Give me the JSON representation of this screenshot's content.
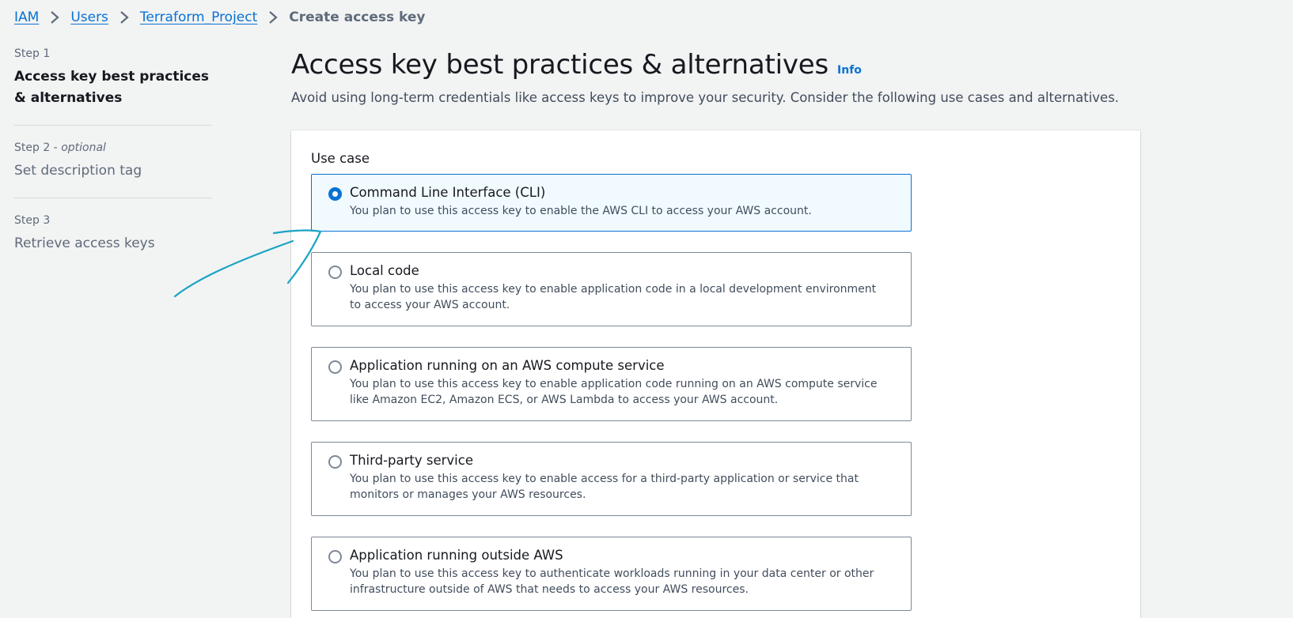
{
  "breadcrumb": {
    "items": [
      "IAM",
      "Users",
      "Terraform_Project"
    ],
    "current": "Create access key"
  },
  "steps": [
    {
      "number": "Step 1",
      "optional": "",
      "title": "Access key best practices & alternatives",
      "active": true
    },
    {
      "number": "Step 2 - ",
      "optional": "optional",
      "title": "Set description tag",
      "active": false
    },
    {
      "number": "Step 3",
      "optional": "",
      "title": "Retrieve access keys",
      "active": false
    }
  ],
  "header": {
    "title": "Access key best practices & alternatives",
    "info": "Info",
    "subtitle": "Avoid using long-term credentials like access keys to improve your security. Consider the following use cases and alternatives."
  },
  "use_case": {
    "label": "Use case",
    "selected_index": 0,
    "options": [
      {
        "label": "Command Line Interface (CLI)",
        "description": "You plan to use this access key to enable the AWS CLI to access your AWS account."
      },
      {
        "label": "Local code",
        "description": "You plan to use this access key to enable application code in a local development environment to access your AWS account."
      },
      {
        "label": "Application running on an AWS compute service",
        "description": "You plan to use this access key to enable application code running on an AWS compute service like Amazon EC2, Amazon ECS, or AWS Lambda to access your AWS account."
      },
      {
        "label": "Third-party service",
        "description": "You plan to use this access key to enable access for a third-party application or service that monitors or manages your AWS resources."
      },
      {
        "label": "Application running outside AWS",
        "description": "You plan to use this access key to authenticate workloads running in your data center or other infrastructure outside of AWS that needs to access your AWS resources."
      }
    ]
  },
  "colors": {
    "link": "#0972d3",
    "selected_bg": "#f1faff",
    "annotation": "#1aa3c4"
  },
  "icons": {
    "breadcrumb_separator": "chevron-right-icon",
    "annotation": "hand-drawn-arrow-icon"
  }
}
